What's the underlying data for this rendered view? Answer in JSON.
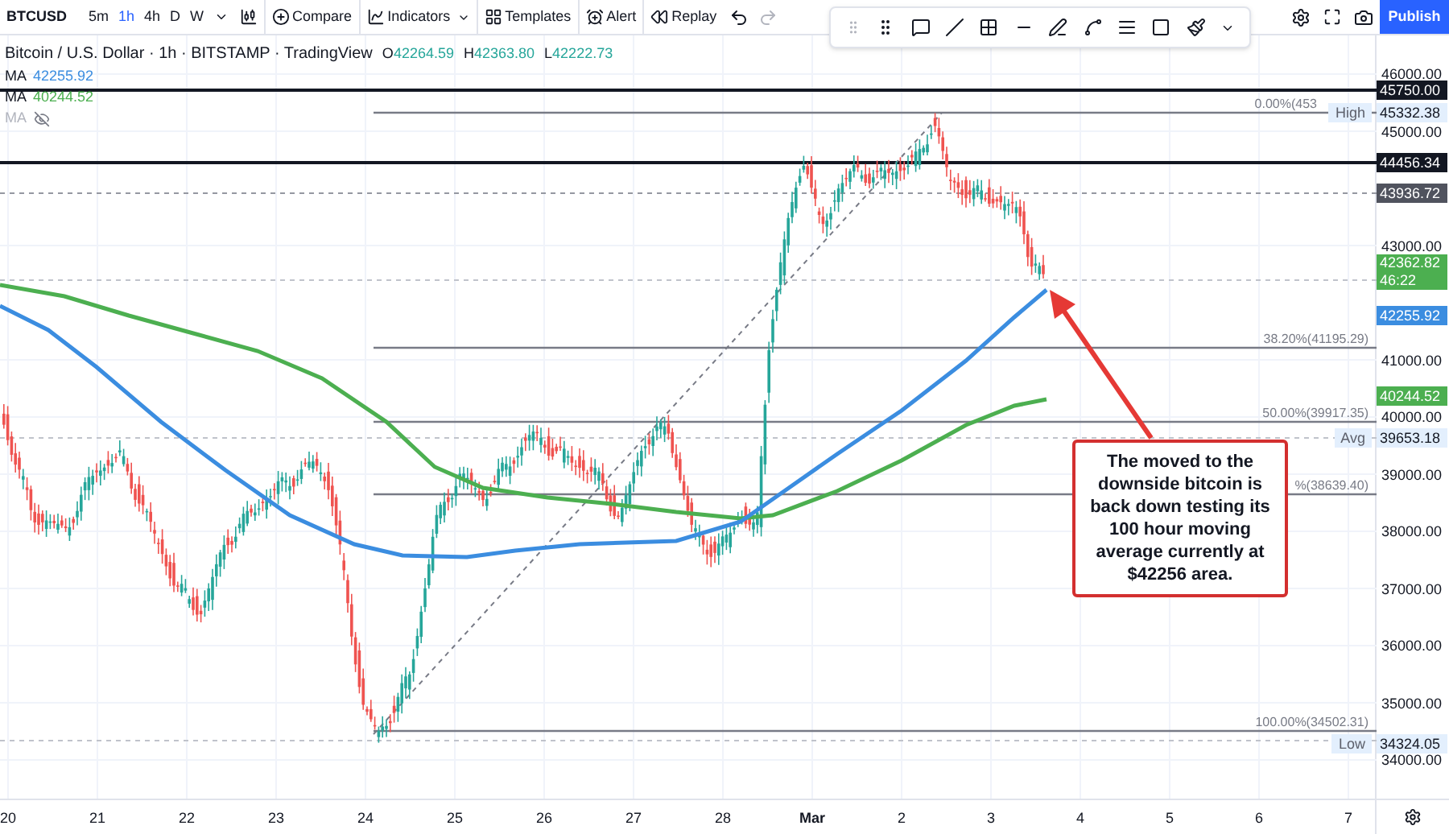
{
  "toolbar": {
    "symbol": "BTCUSD",
    "intervals": [
      {
        "label": "5m",
        "selected": false
      },
      {
        "label": "1h",
        "selected": true
      },
      {
        "label": "4h",
        "selected": false
      },
      {
        "label": "D",
        "selected": false
      },
      {
        "label": "W",
        "selected": false
      }
    ],
    "buttons": [
      {
        "label": "Compare",
        "kind": "compare"
      },
      {
        "label": "Indicators",
        "kind": "indicators"
      },
      {
        "label": "Templates",
        "kind": "templates"
      },
      {
        "label": "Alert",
        "kind": "alert"
      },
      {
        "label": "Replay",
        "kind": "replay"
      }
    ],
    "publish": "Publish"
  },
  "legend": {
    "title": "Bitcoin / U.S. Dollar · 1h · BITSTAMP · TradingView",
    "ohlc": [
      {
        "label": "O",
        "value": "42264.59"
      },
      {
        "label": "H",
        "value": "42363.80"
      },
      {
        "label": "L",
        "value": "42222.73"
      }
    ],
    "mas": [
      {
        "label": "MA",
        "value": "42255.92",
        "color": "#3b8de0",
        "visible": true
      },
      {
        "label": "MA",
        "value": "40244.52",
        "color": "#4caf50",
        "visible": true
      },
      {
        "label": "MA",
        "visible": false
      }
    ]
  },
  "price_ticks": [
    "46000.00",
    "45000.00",
    "43000.00",
    "41000.00",
    "40000.00",
    "39000.00",
    "38000.00",
    "37000.00",
    "36000.00",
    "35000.00",
    "34000.00"
  ],
  "price_labels": [
    {
      "kind": "line",
      "text": "45750.00"
    },
    {
      "kind": "stat",
      "tag": "High",
      "text": "45332.38"
    },
    {
      "kind": "line",
      "text": "44456.34"
    },
    {
      "kind": "marker",
      "text": "43936.72"
    },
    {
      "kind": "last",
      "text": "42362.82",
      "countdown": "46:22"
    },
    {
      "kind": "ma",
      "text": "42255.92",
      "color": "#3b8de0"
    },
    {
      "kind": "ma",
      "text": "40244.52",
      "color": "#4caf50"
    },
    {
      "kind": "stat",
      "tag": "Avg",
      "text": "39653.18"
    },
    {
      "kind": "stat",
      "tag": "Low",
      "text": "34324.05"
    }
  ],
  "fib_levels": [
    {
      "label": "0.00%(453"
    },
    {
      "label": "38.20%(41195.29)"
    },
    {
      "label": "50.00%(39917.35)"
    },
    {
      "label": "%(38639.40)"
    },
    {
      "label": "100.00%(34502.31)"
    }
  ],
  "dates": [
    {
      "label": "20",
      "month": false
    },
    {
      "label": "21",
      "month": false
    },
    {
      "label": "22",
      "month": false
    },
    {
      "label": "23",
      "month": false
    },
    {
      "label": "24",
      "month": false
    },
    {
      "label": "25",
      "month": false
    },
    {
      "label": "26",
      "month": false
    },
    {
      "label": "27",
      "month": false
    },
    {
      "label": "28",
      "month": false
    },
    {
      "label": "Mar",
      "month": true
    },
    {
      "label": "2",
      "month": false
    },
    {
      "label": "3",
      "month": false
    },
    {
      "label": "4",
      "month": false
    },
    {
      "label": "5",
      "month": false
    },
    {
      "label": "6",
      "month": false
    },
    {
      "label": "7",
      "month": false
    }
  ],
  "annotation": "The moved to the downside bitcoin is back down testing its 100 hour moving average currently at $42256 area."
}
